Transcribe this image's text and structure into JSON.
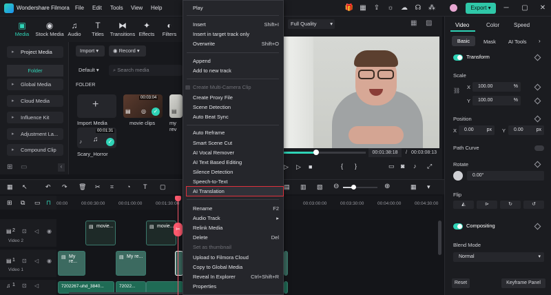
{
  "app": {
    "title": "Wondershare Filmora",
    "menu": [
      "File",
      "Edit",
      "Tools",
      "View",
      "Help"
    ],
    "export_label": "Export"
  },
  "toolbar": {
    "items": [
      {
        "label": "Media",
        "icon": "media-icon"
      },
      {
        "label": "Stock Media",
        "icon": "stock-media-icon"
      },
      {
        "label": "Audio",
        "icon": "music-note-icon"
      },
      {
        "label": "Titles",
        "icon": "text-icon"
      },
      {
        "label": "Transitions",
        "icon": "transitions-icon"
      },
      {
        "label": "Effects",
        "icon": "effects-icon"
      },
      {
        "label": "Filters",
        "icon": "filters-icon"
      }
    ]
  },
  "sidebar": {
    "items": [
      "Project Media",
      "Global Media",
      "Cloud Media",
      "Influence Kit",
      "Adjustment La...",
      "Compound Clip"
    ],
    "folder": "Folder"
  },
  "media": {
    "import": "Import",
    "record": "Record",
    "default": "Default",
    "search_placeholder": "Search media",
    "folder_label": "FOLDER",
    "import_media": "Import Media",
    "clips": [
      {
        "name": "movie clips",
        "duration": "00:03:04"
      },
      {
        "name": "my rev",
        "duration": ""
      },
      {
        "name": "Scary_Horror",
        "duration": "00:01:31"
      }
    ]
  },
  "preview": {
    "quality": "Full Quality",
    "current_time": "00:01:38:18",
    "separator": "/",
    "total_time": "00:03:08:13",
    "progress": 0.2
  },
  "right_panel": {
    "tabs": [
      "Video",
      "Color",
      "Speed"
    ],
    "subtabs": [
      "Basic",
      "Mask",
      "AI Tools"
    ],
    "transform": "Transform",
    "scale": "Scale",
    "scale_x": "100.00",
    "scale_y": "100.00",
    "percent": "%",
    "x_label": "X",
    "y_label": "Y",
    "position": "Position",
    "pos_x": "0.00",
    "pos_y": "0.00",
    "px": "px",
    "path_curve": "Path Curve",
    "rotate": "Rotate",
    "rotate_value": "0.00°",
    "flip": "Flip",
    "compositing": "Compositing",
    "blend_mode": "Blend Mode",
    "blend_value": "Normal",
    "reset": "Reset",
    "keyframe": "Keyframe Panel"
  },
  "timeline": {
    "ruler": [
      "00:00",
      "00:00:30:00",
      "00:01:00:00",
      "00:01:30:00",
      "00:03:00:00",
      "00:03:30:00",
      "00:04:00:00",
      "00:04:30:00",
      "00:05:00:00"
    ],
    "tracks": [
      {
        "num": "2",
        "label": "Video 2"
      },
      {
        "num": "1",
        "label": "Video 1"
      },
      {
        "num": "1",
        "label": ""
      }
    ],
    "clips_v2": [
      "movie...",
      "movie..."
    ],
    "clips_v1": [
      "My re...",
      "My re..."
    ],
    "audio_clips": [
      "7202267-uhd_3840...",
      "72022..."
    ]
  },
  "context_menu": {
    "items": [
      {
        "label": "Play",
        "shortcut": "",
        "disabled": false
      },
      {
        "label": "Insert",
        "shortcut": "Shift+I",
        "disabled": false
      },
      {
        "label": "Insert in target track only",
        "shortcut": "",
        "disabled": false
      },
      {
        "label": "Overwrite",
        "shortcut": "Shift+O",
        "disabled": false
      },
      {
        "label": "Append",
        "shortcut": "",
        "disabled": false
      },
      {
        "label": "Add to new track",
        "shortcut": "",
        "disabled": false
      },
      {
        "label": "Create Multi-Camera Clip",
        "shortcut": "",
        "disabled": true
      },
      {
        "label": "Create Proxy File",
        "shortcut": "",
        "disabled": false
      },
      {
        "label": "Scene Detection",
        "shortcut": "",
        "disabled": false
      },
      {
        "label": "Auto Beat Sync",
        "shortcut": "",
        "disabled": false
      },
      {
        "label": "Auto Reframe",
        "shortcut": "",
        "disabled": false
      },
      {
        "label": "Smart Scene Cut",
        "shortcut": "",
        "disabled": false
      },
      {
        "label": "AI Vocal Remover",
        "shortcut": "",
        "disabled": false
      },
      {
        "label": "AI Text Based Editing",
        "shortcut": "",
        "disabled": false
      },
      {
        "label": "Silence Detection",
        "shortcut": "",
        "disabled": false
      },
      {
        "label": "Speech-to-Text",
        "shortcut": "",
        "disabled": false
      },
      {
        "label": "AI Translation",
        "shortcut": "",
        "disabled": false
      },
      {
        "label": "Rename",
        "shortcut": "F2",
        "disabled": false
      },
      {
        "label": "Audio Track",
        "shortcut": "▸",
        "disabled": false
      },
      {
        "label": "Relink Media",
        "shortcut": "",
        "disabled": false
      },
      {
        "label": "Delete",
        "shortcut": "Del",
        "disabled": false
      },
      {
        "label": "Set as thumbnail",
        "shortcut": "",
        "disabled": true
      },
      {
        "label": "Upload to Filmora Cloud",
        "shortcut": "",
        "disabled": false
      },
      {
        "label": "Copy to Global Media",
        "shortcut": "",
        "disabled": false
      },
      {
        "label": "Reveal In Explorer",
        "shortcut": "Ctrl+Shift+R",
        "disabled": false
      },
      {
        "label": "Properties",
        "shortcut": "",
        "disabled": false
      }
    ]
  },
  "colors": {
    "accent": "#2fd3b6",
    "highlight": "#e0313d",
    "playhead": "#ff5a6e"
  }
}
